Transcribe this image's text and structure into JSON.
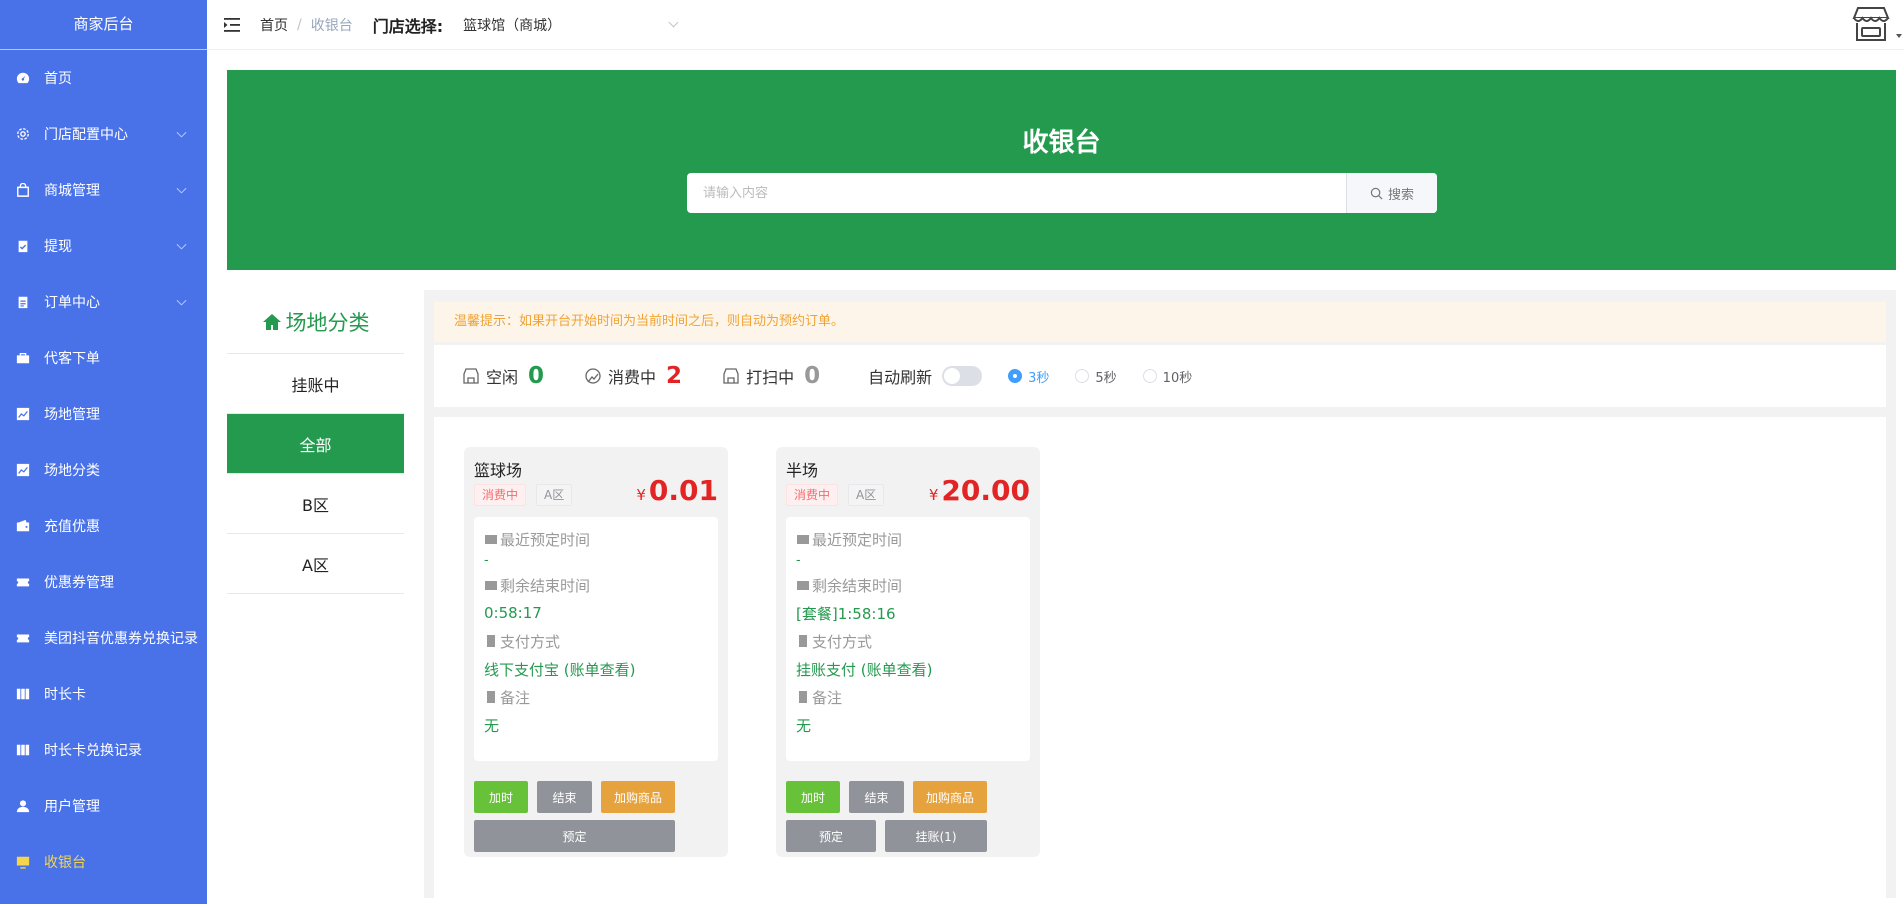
{
  "sidebar": {
    "brand": "商家后台",
    "items": [
      {
        "label": "首页"
      },
      {
        "label": "门店配置中心"
      },
      {
        "label": "商城管理"
      },
      {
        "label": "提现"
      },
      {
        "label": "订单中心"
      },
      {
        "label": "代客下单"
      },
      {
        "label": "场地管理"
      },
      {
        "label": "场地分类"
      },
      {
        "label": "充值优惠"
      },
      {
        "label": "优惠券管理"
      },
      {
        "label": "美团抖音优惠券兑换记录"
      },
      {
        "label": "时长卡"
      },
      {
        "label": "时长卡兑换记录"
      },
      {
        "label": "用户管理"
      },
      {
        "label": "收银台"
      }
    ]
  },
  "header": {
    "breadcrumb_home": "首页",
    "breadcrumb_sep": "/",
    "breadcrumb_current": "收银台",
    "store_label": "门店选择:",
    "store_value": "篮球馆（商城）"
  },
  "banner": {
    "title": "收银台",
    "search_placeholder": "请输入内容",
    "search_button": "搜索"
  },
  "categories": {
    "title": "场地分类",
    "items": [
      "挂账中",
      "全部",
      "B区",
      "A区"
    ]
  },
  "notice": "温馨提示：如果开台开始时间为当前时间之后，则自动为预约订单。",
  "stats": {
    "idle_label": "空闲",
    "idle_count": "0",
    "busy_label": "消费中",
    "busy_count": "2",
    "cleaning_label": "打扫中",
    "cleaning_count": "0",
    "auto_refresh_label": "自动刷新",
    "auto_refresh_on": false,
    "intervals": [
      "3秒",
      "5秒",
      "10秒"
    ],
    "selected_interval": "3秒"
  },
  "cards": [
    {
      "name": "篮球场",
      "status_tag": "消费中",
      "zone_tag": "A区",
      "currency": "¥",
      "price": "0.01",
      "recent_booking_label": "最近预定时间",
      "recent_booking_value": "-",
      "remaining_label": "剩余结束时间",
      "remaining_value": "0:58:17",
      "payment_label": "支付方式",
      "payment_value": "线下支付宝 (账单查看)",
      "remark_label": "备注",
      "remark_value": "无",
      "btn_add_time": "加时",
      "btn_end": "结束",
      "btn_add_goods": "加购商品",
      "btn_reserve": "预定"
    },
    {
      "name": "半场",
      "status_tag": "消费中",
      "zone_tag": "A区",
      "currency": "¥",
      "price": "20.00",
      "recent_booking_label": "最近预定时间",
      "recent_booking_value": "-",
      "remaining_label": "剩余结束时间",
      "remaining_value": "[套餐]1:58:16",
      "payment_label": "支付方式",
      "payment_value": "挂账支付 (账单查看)",
      "remark_label": "备注",
      "remark_value": "无",
      "btn_add_time": "加时",
      "btn_end": "结束",
      "btn_add_goods": "加购商品",
      "btn_reserve": "预定",
      "btn_credit": "挂账(1)"
    }
  ],
  "colors": {
    "sidebar_bg": "#4a72e8",
    "active_menu": "#f5d64a",
    "brand_green": "#249a4f",
    "price_red": "#e32424",
    "notice_text": "#f0a334"
  },
  "icons": {
    "menu": [
      "dashboard-icon",
      "gear-icon",
      "shopping-bag-icon",
      "clipboard-check-icon",
      "clipboard-list-icon",
      "briefcase-icon",
      "line-chart-icon",
      "line-chart-icon",
      "wallet-icon",
      "ticket-icon",
      "ticket-icon",
      "columns-icon",
      "columns-icon",
      "user-icon",
      "monitor-icon"
    ]
  }
}
